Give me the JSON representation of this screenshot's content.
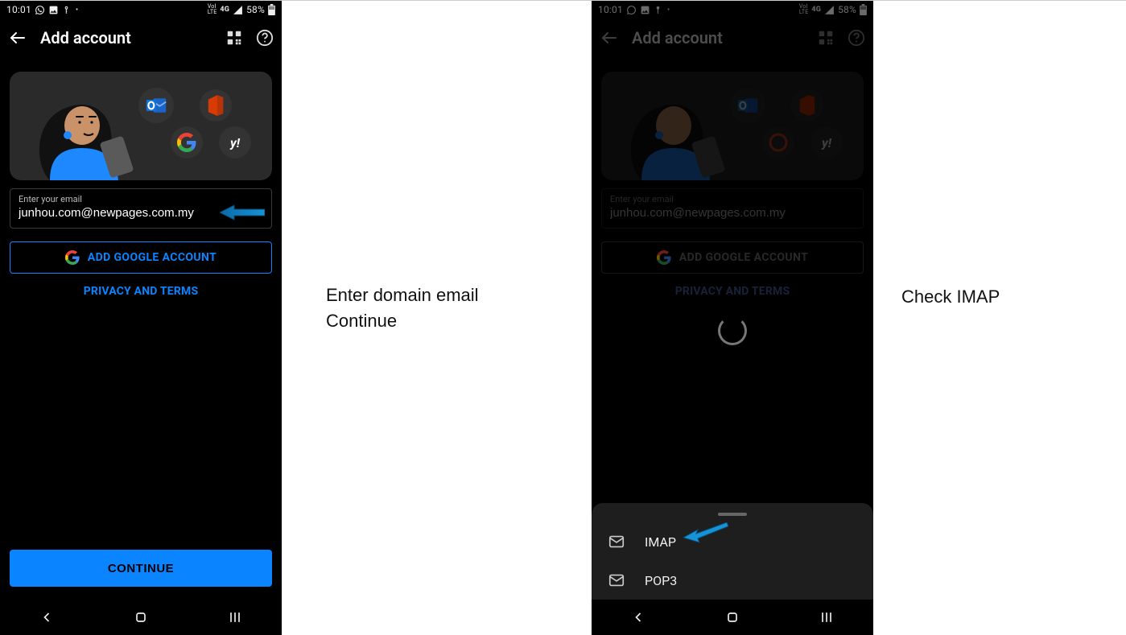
{
  "status": {
    "time": "10:01",
    "battery": "58%"
  },
  "appbar": {
    "title": "Add account"
  },
  "field": {
    "label": "Enter your email",
    "value": "junhou.com@newpages.com.my"
  },
  "buttons": {
    "google": "ADD GOOGLE ACCOUNT",
    "privacy": "PRIVACY AND TERMS",
    "continue": "CONTINUE"
  },
  "sheet": {
    "imap": "IMAP",
    "pop3": "POP3"
  },
  "captions": {
    "left_line1": "Enter domain email",
    "left_line2": "Continue",
    "right": "Check IMAP"
  }
}
